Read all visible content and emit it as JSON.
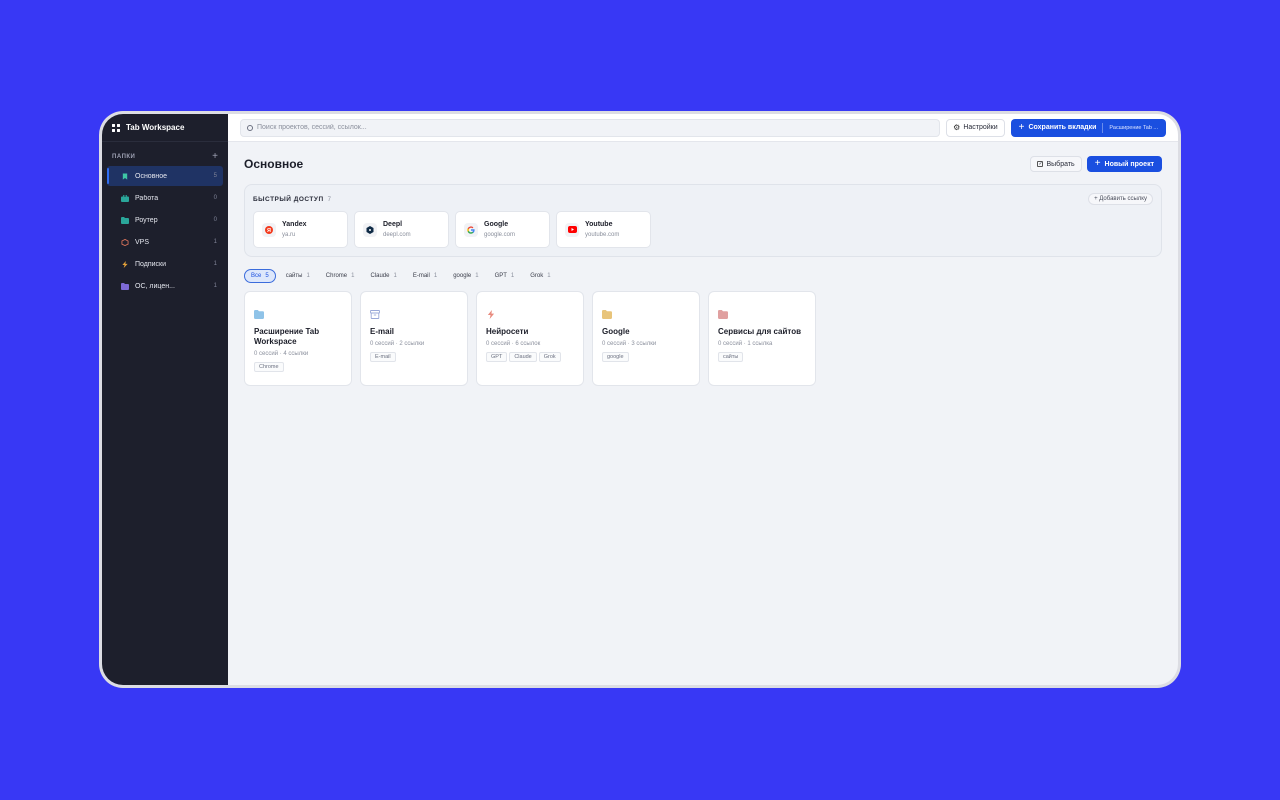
{
  "app": {
    "name": "Tab Workspace"
  },
  "sidebar": {
    "section_title": "ПАПКИ",
    "items": [
      {
        "label": "Основное",
        "count": "5",
        "icon": "bookmark-icon",
        "color": "#3ec7a6",
        "active": true
      },
      {
        "label": "Работа",
        "count": "0",
        "icon": "briefcase-icon",
        "color": "#2aa69a"
      },
      {
        "label": "Роутер",
        "count": "0",
        "icon": "folder-icon",
        "color": "#2aa69a"
      },
      {
        "label": "VPS",
        "count": "1",
        "icon": "box-icon",
        "color": "#d9735b"
      },
      {
        "label": "Подписки",
        "count": "1",
        "icon": "bolt-icon",
        "color": "#e5a23a"
      },
      {
        "label": "ОС, лицен...",
        "count": "1",
        "icon": "folder-icon",
        "color": "#7d6ad6"
      }
    ]
  },
  "topbar": {
    "search_placeholder": "Поиск проектов, сессий, ссылок...",
    "settings_label": "Настройки",
    "save_label": "Сохранить вкладки",
    "save_ext_label": "Расширение Tab ..."
  },
  "page": {
    "title": "Основное",
    "select_label": "Выбрать",
    "new_project_label": "Новый проект"
  },
  "quick_access": {
    "title": "БЫСТРЫЙ ДОСТУП",
    "count": "7",
    "add_link_label": "+ Добавить ссылку",
    "links": [
      {
        "name": "Yandex",
        "url": "ya.ru",
        "icon": "yandex-icon"
      },
      {
        "name": "Deepl",
        "url": "deepl.com",
        "icon": "deepl-icon"
      },
      {
        "name": "Google",
        "url": "google.com",
        "icon": "google-icon"
      },
      {
        "name": "Youtube",
        "url": "youtube.com",
        "icon": "youtube-icon"
      }
    ]
  },
  "filters": [
    {
      "label": "Все",
      "count": "5",
      "active": true
    },
    {
      "label": "сайты",
      "count": "1"
    },
    {
      "label": "Chrome",
      "count": "1"
    },
    {
      "label": "Claude",
      "count": "1"
    },
    {
      "label": "E-mail",
      "count": "1"
    },
    {
      "label": "google",
      "count": "1"
    },
    {
      "label": "GPT",
      "count": "1"
    },
    {
      "label": "Grok",
      "count": "1"
    }
  ],
  "projects": [
    {
      "title": "Расширение Tab Workspace",
      "meta": "0 сессий · 4 ссылки",
      "tags": [
        "Chrome"
      ],
      "icon": "folder-icon",
      "color": "#8fc3e8"
    },
    {
      "title": "E-mail",
      "meta": "0 сессий · 2 ссылки",
      "tags": [
        "E-mail"
      ],
      "icon": "archive-icon",
      "color": "#9aa8d8"
    },
    {
      "title": "Нейросети",
      "meta": "0 сессий · 6 ссылок",
      "tags": [
        "GPT",
        "Claude",
        "Grok"
      ],
      "icon": "bolt-icon",
      "color": "#e88a7d"
    },
    {
      "title": "Google",
      "meta": "0 сессий · 3 ссылки",
      "tags": [
        "google"
      ],
      "icon": "folder-icon",
      "color": "#e8c47a"
    },
    {
      "title": "Сервисы для сайтов",
      "meta": "0 сессий · 1 ссылка",
      "tags": [
        "сайты"
      ],
      "icon": "folder-icon",
      "color": "#e0a0a0"
    }
  ]
}
